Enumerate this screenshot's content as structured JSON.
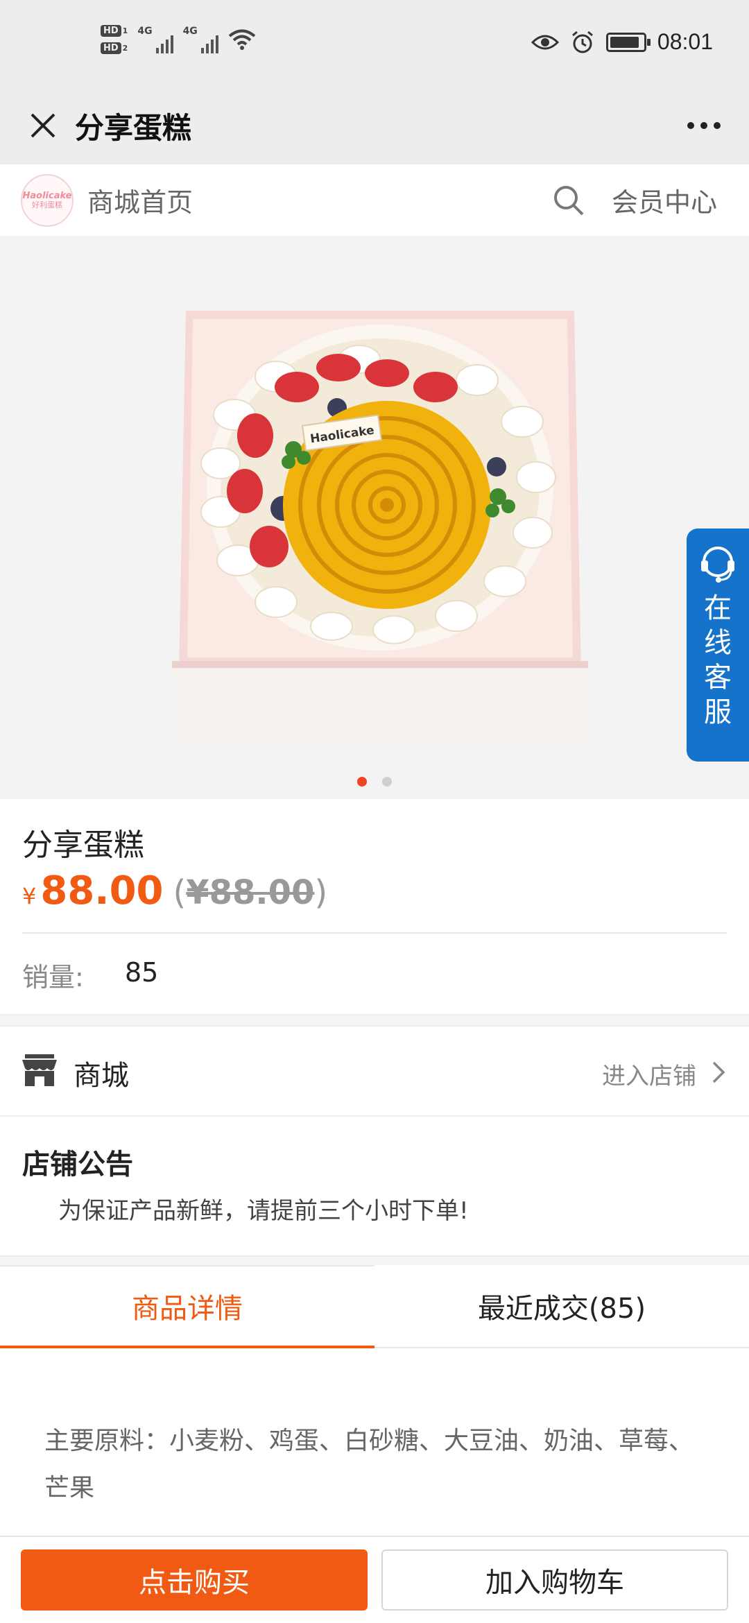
{
  "status_bar": {
    "hd1": "HD",
    "hd1_sub": "1",
    "hd2": "HD",
    "hd2_sub": "2",
    "net1": "4G",
    "net2": "4G",
    "battery_percent": 90,
    "time": "08:01"
  },
  "title_bar": {
    "title": "分享蛋糕"
  },
  "shop_header": {
    "logo_text": "Haolicake",
    "logo_subtext": "好利蛋糕",
    "home_label": "商城首页",
    "member_label": "会员中心"
  },
  "gallery": {
    "image_count": 2,
    "active_index": 0,
    "service_tab_label": "在线客服",
    "cake_tag": "Haolicake"
  },
  "product": {
    "name": "分享蛋糕",
    "currency": "¥",
    "price": "88.00",
    "original_price_open": "(",
    "original_price": "¥88.00",
    "original_price_close": ")",
    "sales_label": "销量:",
    "sales_value": "85"
  },
  "store": {
    "name": "商城",
    "enter_label": "进入店铺"
  },
  "notice": {
    "title": "店铺公告",
    "text": "为保证产品新鲜，请提前三个小时下单!"
  },
  "tabs": [
    {
      "label": "商品详情",
      "active": true
    },
    {
      "label": "最近成交(85)",
      "active": false
    }
  ],
  "details": {
    "text": "主要原料：小麦粉、鸡蛋、白砂糖、大豆油、奶油、草莓、芒果"
  },
  "actions": {
    "buy_label": "点击购买",
    "cart_label": "加入购物车"
  },
  "colors": {
    "accent": "#f05a12",
    "service_blue": "#1673cc",
    "dot_active": "#f0431f"
  }
}
